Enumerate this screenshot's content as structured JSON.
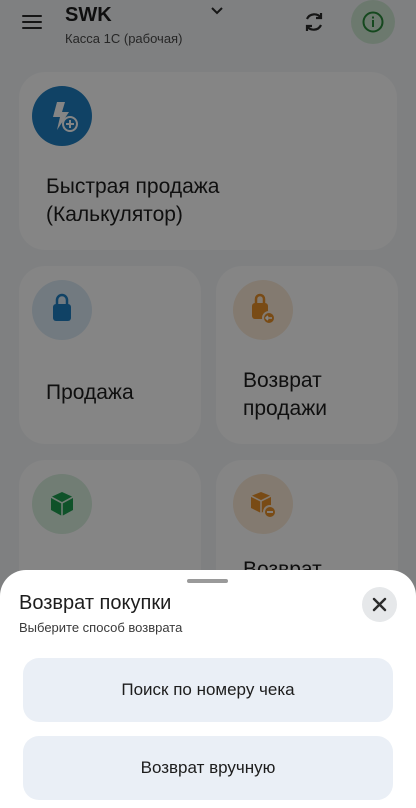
{
  "header": {
    "title": "SWK",
    "subtitle": "Касса 1С (рабочая)"
  },
  "tiles": [
    {
      "label": "Быстрая продажа\n(Калькулятор)",
      "icon": "lightning-plus-icon",
      "color": "#1f7fc1"
    },
    {
      "label": "Продажа",
      "icon": "shopping-bag-icon",
      "color": "#1f7fc1"
    },
    {
      "label": "Возврат\nпродажи",
      "icon": "bag-return-icon",
      "color": "#e8902a"
    },
    {
      "label": "",
      "icon": "box-icon",
      "color": "#1e9e4f"
    },
    {
      "label": "Возврат",
      "icon": "box-return-icon",
      "color": "#e8902a"
    }
  ],
  "sheet": {
    "title": "Возврат покупки",
    "subtitle": "Выберите способ возврата",
    "options": [
      {
        "label": "Поиск по номеру чека"
      },
      {
        "label": "Возврат вручную"
      }
    ]
  },
  "colors": {
    "accent_blue": "#1f7fc1",
    "accent_orange": "#e8902a",
    "accent_green": "#1e9e4f",
    "info_green": "#2a8a3a"
  }
}
